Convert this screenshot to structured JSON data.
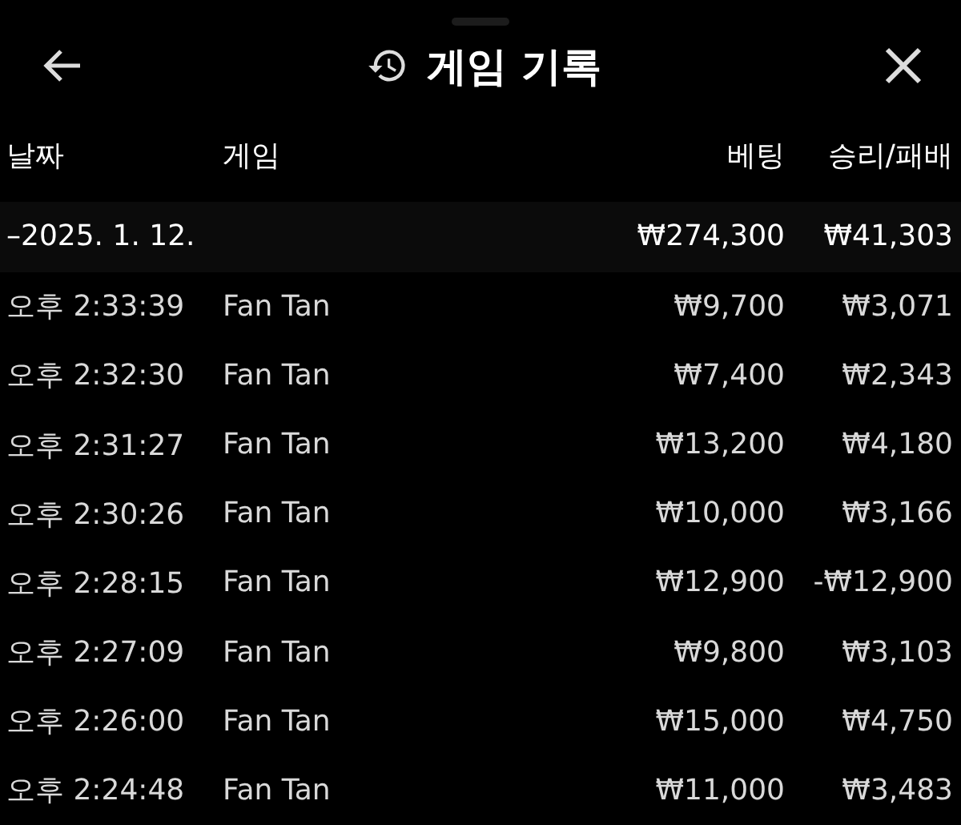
{
  "header": {
    "title": "게임 기록"
  },
  "table": {
    "columns": [
      "날짜",
      "게임",
      "베팅",
      "승리/패배"
    ],
    "summary": {
      "date": "–2025. 1. 12.",
      "bet": "₩274,300",
      "result": "₩41,303"
    },
    "rows": [
      {
        "time": "오후 2:33:39",
        "game": "Fan Tan",
        "bet": "₩9,700",
        "result": "₩3,071"
      },
      {
        "time": "오후 2:32:30",
        "game": "Fan Tan",
        "bet": "₩7,400",
        "result": "₩2,343"
      },
      {
        "time": "오후 2:31:27",
        "game": "Fan Tan",
        "bet": "₩13,200",
        "result": "₩4,180"
      },
      {
        "time": "오후 2:30:26",
        "game": "Fan Tan",
        "bet": "₩10,000",
        "result": "₩3,166"
      },
      {
        "time": "오후 2:28:15",
        "game": "Fan Tan",
        "bet": "₩12,900",
        "result": "-₩12,900"
      },
      {
        "time": "오후 2:27:09",
        "game": "Fan Tan",
        "bet": "₩9,800",
        "result": "₩3,103"
      },
      {
        "time": "오후 2:26:00",
        "game": "Fan Tan",
        "bet": "₩15,000",
        "result": "₩4,750"
      },
      {
        "time": "오후 2:24:48",
        "game": "Fan Tan",
        "bet": "₩11,000",
        "result": "₩3,483"
      }
    ]
  }
}
